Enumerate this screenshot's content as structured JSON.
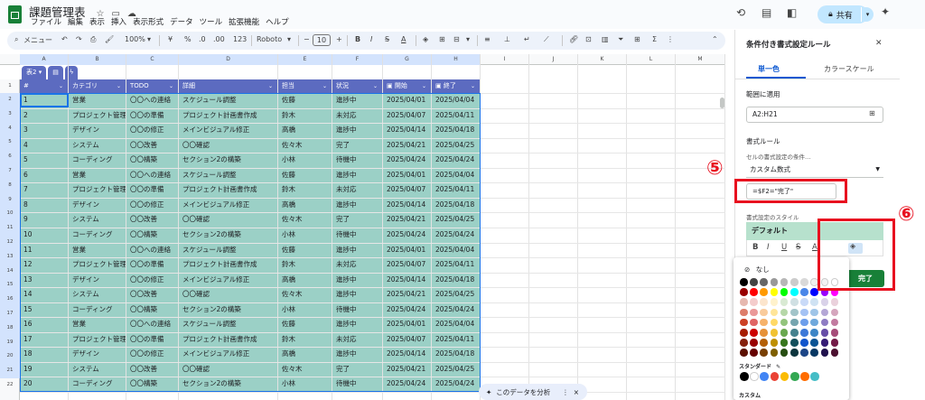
{
  "title_bar": {
    "doc_title": "課題管理表",
    "menu": [
      "ファイル",
      "編集",
      "表示",
      "挿入",
      "表示形式",
      "データ",
      "ツール",
      "拡張機能",
      "ヘルプ"
    ],
    "share_label": "共有"
  },
  "toolbar": {
    "search_label": "メニュー",
    "zoom": "100%",
    "currency": "¥",
    "percent": "%",
    "decimal_dec": ".0",
    "decimal_inc": ".00",
    "number_format": "123",
    "font": "Roboto",
    "font_size": "10"
  },
  "sheet": {
    "columns": [
      "A",
      "B",
      "C",
      "D",
      "E",
      "F",
      "G",
      "H",
      "I",
      "J",
      "K",
      "L",
      "M"
    ],
    "table_name": "表2",
    "headers": [
      "#",
      "カテゴリ",
      "TODO",
      "詳細",
      "担当",
      "状況",
      "開始",
      "終了"
    ],
    "rows": [
      [
        "1",
        "営業",
        "〇〇への連絡",
        "スケジュール調整",
        "佐藤",
        "進捗中",
        "2025/04/01",
        "2025/04/04"
      ],
      [
        "2",
        "プロジェクト管理",
        "〇〇の準備",
        "プロジェクト計画書作成",
        "鈴木",
        "未対応",
        "2025/04/07",
        "2025/04/11"
      ],
      [
        "3",
        "デザイン",
        "〇〇の修正",
        "メインビジュアル修正",
        "高橋",
        "進捗中",
        "2025/04/14",
        "2025/04/18"
      ],
      [
        "4",
        "システム",
        "〇〇改善",
        "〇〇確認",
        "佐々木",
        "完了",
        "2025/04/21",
        "2025/04/25"
      ],
      [
        "5",
        "コーディング",
        "〇〇構築",
        "セクション2の構築",
        "小林",
        "待機中",
        "2025/04/24",
        "2025/04/24"
      ],
      [
        "6",
        "営業",
        "〇〇への連絡",
        "スケジュール調整",
        "佐藤",
        "進捗中",
        "2025/04/01",
        "2025/04/04"
      ],
      [
        "7",
        "プロジェクト管理",
        "〇〇の準備",
        "プロジェクト計画書作成",
        "鈴木",
        "未対応",
        "2025/04/07",
        "2025/04/11"
      ],
      [
        "8",
        "デザイン",
        "〇〇の修正",
        "メインビジュアル修正",
        "高橋",
        "進捗中",
        "2025/04/14",
        "2025/04/18"
      ],
      [
        "9",
        "システム",
        "〇〇改善",
        "〇〇確認",
        "佐々木",
        "完了",
        "2025/04/21",
        "2025/04/25"
      ],
      [
        "10",
        "コーディング",
        "〇〇構築",
        "セクション2の構築",
        "小林",
        "待機中",
        "2025/04/24",
        "2025/04/24"
      ],
      [
        "11",
        "営業",
        "〇〇への連絡",
        "スケジュール調整",
        "佐藤",
        "進捗中",
        "2025/04/01",
        "2025/04/04"
      ],
      [
        "12",
        "プロジェクト管理",
        "〇〇の準備",
        "プロジェクト計画書作成",
        "鈴木",
        "未対応",
        "2025/04/07",
        "2025/04/11"
      ],
      [
        "13",
        "デザイン",
        "〇〇の修正",
        "メインビジュアル修正",
        "高橋",
        "進捗中",
        "2025/04/14",
        "2025/04/18"
      ],
      [
        "14",
        "システム",
        "〇〇改善",
        "〇〇確認",
        "佐々木",
        "進捗中",
        "2025/04/21",
        "2025/04/25"
      ],
      [
        "15",
        "コーディング",
        "〇〇構築",
        "セクション2の構築",
        "小林",
        "待機中",
        "2025/04/24",
        "2025/04/24"
      ],
      [
        "16",
        "営業",
        "〇〇への連絡",
        "スケジュール調整",
        "佐藤",
        "進捗中",
        "2025/04/01",
        "2025/04/04"
      ],
      [
        "17",
        "プロジェクト管理",
        "〇〇の準備",
        "プロジェクト計画書作成",
        "鈴木",
        "未対応",
        "2025/04/07",
        "2025/04/11"
      ],
      [
        "18",
        "デザイン",
        "〇〇の修正",
        "メインビジュアル修正",
        "高橋",
        "進捗中",
        "2025/04/14",
        "2025/04/18"
      ],
      [
        "19",
        "システム",
        "〇〇改善",
        "〇〇確認",
        "佐々木",
        "完了",
        "2025/04/21",
        "2025/04/25"
      ],
      [
        "20",
        "コーディング",
        "〇〇構築",
        "セクション2の構築",
        "小林",
        "待機中",
        "2025/04/24",
        "2025/04/24"
      ]
    ],
    "row_numbers": [
      "1",
      "2",
      "3",
      "4",
      "5",
      "6",
      "7",
      "8",
      "9",
      "10",
      "11",
      "12",
      "13",
      "14",
      "15",
      "16",
      "17",
      "18",
      "19",
      "20",
      "21",
      "22"
    ],
    "analyze_label": "このデータを分析"
  },
  "panel": {
    "title": "条件付き書式設定ルール",
    "tab_single": "単一色",
    "tab_scale": "カラースケール",
    "range_label": "範囲に適用",
    "range_value": "A2:H21",
    "rules_label": "書式ルール",
    "condition_label": "セルの書式設定の条件…",
    "condition_value": "カスタム数式",
    "formula": "=$F2=\"完了\"",
    "style_label": "書式設定のスタイル",
    "style_preview": "デフォルト",
    "format_buttons": [
      "B",
      "I",
      "U",
      "S",
      "A"
    ],
    "done_label": "完了"
  },
  "palette": {
    "none_label": "なし",
    "standard_label": "スタンダード",
    "custom_label": "カスタム",
    "grid": [
      [
        "#000000",
        "#434343",
        "#666666",
        "#999999",
        "#b7b7b7",
        "#cccccc",
        "#d9d9d9",
        "#efefef",
        "#f3f3f3",
        "#ffffff"
      ],
      [
        "#980000",
        "#ff0000",
        "#ff9900",
        "#ffff00",
        "#00ff00",
        "#00ffff",
        "#4a86e8",
        "#0000ff",
        "#9900ff",
        "#ff00ff"
      ],
      [
        "#e6b8af",
        "#f4cccc",
        "#fce5cd",
        "#fff2cc",
        "#d9ead3",
        "#d0e0e3",
        "#c9daf8",
        "#cfe2f3",
        "#d9d2e9",
        "#ead1dc"
      ],
      [
        "#dd7e6b",
        "#ea9999",
        "#f9cb9c",
        "#ffe599",
        "#b6d7a8",
        "#a2c4c9",
        "#a4c2f4",
        "#9fc5e8",
        "#b4a7d6",
        "#d5a6bd"
      ],
      [
        "#cc4125",
        "#e06666",
        "#f6b26b",
        "#ffd966",
        "#93c47d",
        "#76a5af",
        "#6d9eeb",
        "#6fa8dc",
        "#8e7cc3",
        "#c27ba0"
      ],
      [
        "#a61c00",
        "#cc0000",
        "#e69138",
        "#f1c232",
        "#6aa84f",
        "#45818e",
        "#3c78d8",
        "#3d85c6",
        "#674ea7",
        "#a64d79"
      ],
      [
        "#85200c",
        "#990000",
        "#b45f06",
        "#bf9000",
        "#38761d",
        "#134f5c",
        "#1155cc",
        "#0b5394",
        "#351c75",
        "#741b47"
      ],
      [
        "#5b0f00",
        "#660000",
        "#783f04",
        "#7f6000",
        "#274e13",
        "#0c343d",
        "#1c4587",
        "#073763",
        "#20124d",
        "#4c1130"
      ]
    ],
    "standard": [
      "#000000",
      "#ffffff",
      "#4285f4",
      "#ea4335",
      "#fbbc04",
      "#34a853",
      "#ff6d01",
      "#46bdc6"
    ]
  },
  "annotations": {
    "five": "⑤",
    "six": "⑥",
    "color": "#e8101f"
  }
}
